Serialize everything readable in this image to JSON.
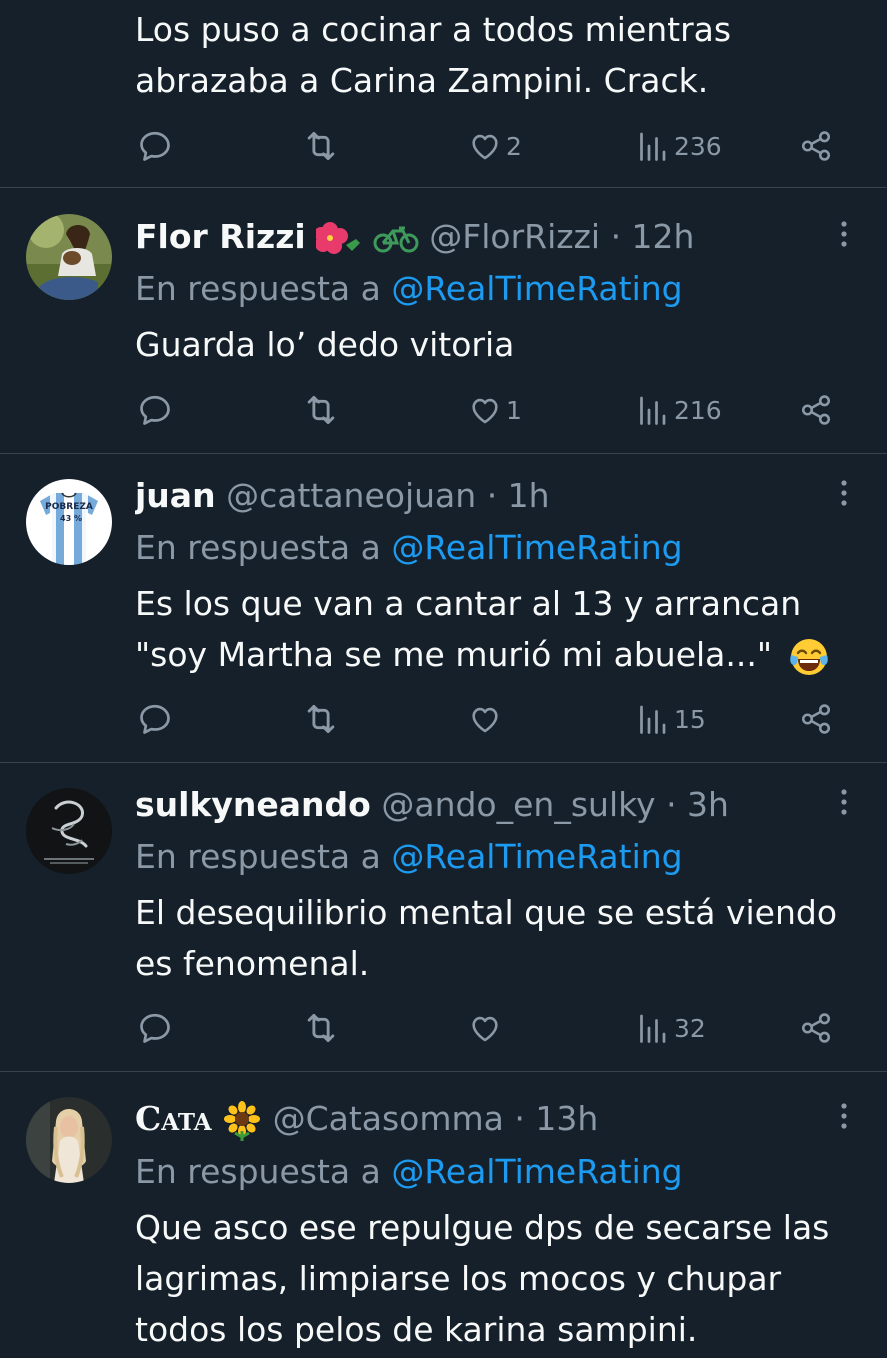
{
  "colors": {
    "background": "#15202b",
    "text": "#f7f9f9",
    "muted": "#8b98a5",
    "link": "#1d9bf0",
    "divider": "#38444d"
  },
  "tweets": [
    {
      "lines": [
        "Los puso a cocinar a todos mientras",
        "abrazaba a Carina Zampini. Crack."
      ],
      "likes": "2",
      "views": "236"
    },
    {
      "name": "Flor Rizzi",
      "name_emoji": [
        "hibiscus-emoji",
        "bicycle-emoji"
      ],
      "handle": "@FlorRizzi",
      "time": "· 12h",
      "reply_prefix": "En respuesta a",
      "reply_handle": "@RealTimeRating",
      "lines": [
        "Guarda lo’ dedo vitoria"
      ],
      "likes": "1",
      "views": "216"
    },
    {
      "name": "juan",
      "handle": "@cattaneojuan",
      "time": "· 1h",
      "avatar_text": [
        "POBREZA",
        "43 %"
      ],
      "reply_prefix": "En respuesta a",
      "reply_handle": "@RealTimeRating",
      "lines": [
        "Es los que van a cantar al 13 y arrancan",
        "\"soy Martha se me murió mi abuela...\""
      ],
      "line_emoji": "tears-of-joy-emoji",
      "likes": "",
      "views": "15"
    },
    {
      "name": "sulkyneando",
      "handle": "@ando_en_sulky",
      "time": "· 3h",
      "reply_prefix": "En respuesta a",
      "reply_handle": "@RealTimeRating",
      "lines": [
        "El desequilibrio mental que se está viendo",
        "es fenomenal."
      ],
      "likes": "",
      "views": "32"
    },
    {
      "name": "Cata",
      "name_emoji": [
        "sunflower-emoji"
      ],
      "handle": "@Catasomma",
      "time": "· 13h",
      "reply_prefix": "En respuesta a",
      "reply_handle": "@RealTimeRating",
      "lines": [
        "Que asco ese repulgue dps de secarse las",
        "lagrimas, limpiarse los mocos y chupar",
        "todos los pelos de karina sampini."
      ]
    }
  ]
}
